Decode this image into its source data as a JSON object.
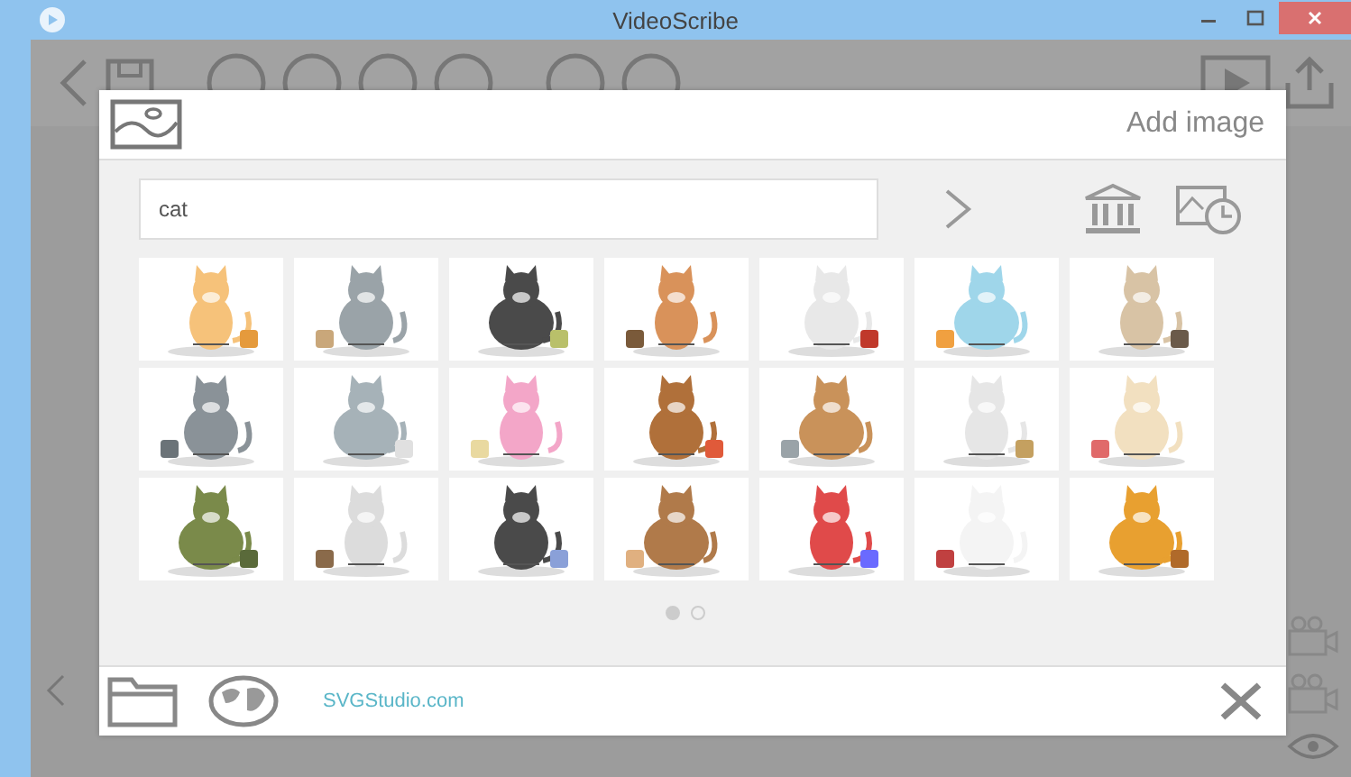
{
  "window": {
    "title": "VideoScribe"
  },
  "dialog": {
    "title": "Add image",
    "search": {
      "value": "cat"
    },
    "pages": [
      {
        "selected": true
      },
      {
        "selected": false
      }
    ],
    "footer_link": "SVGStudio.com"
  }
}
